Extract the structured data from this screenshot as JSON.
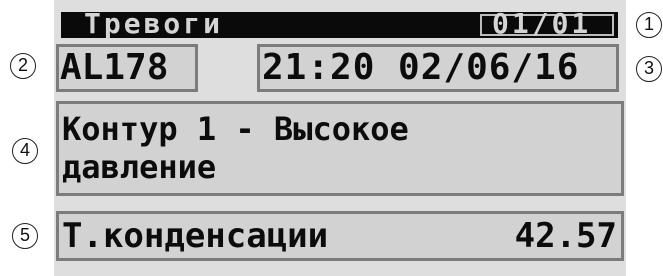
{
  "header": {
    "title": "Тревоги",
    "page_indicator": "01/01"
  },
  "alarm": {
    "code": "AL178",
    "time_date": "21:20 02/06/16",
    "description_line1": "Контур 1 - Высокое",
    "description_line2": "давление",
    "parameter_label": "Т.конденсации",
    "parameter_value": "42.57"
  },
  "callouts": {
    "c1": "1",
    "c2": "2",
    "c3": "3",
    "c4": "4",
    "c5": "5"
  },
  "colors": {
    "lcd_background": "#dedede",
    "title_bar": "#0a0a0a",
    "box_border": "#7c7c7c",
    "text": "#0c0c0c"
  }
}
